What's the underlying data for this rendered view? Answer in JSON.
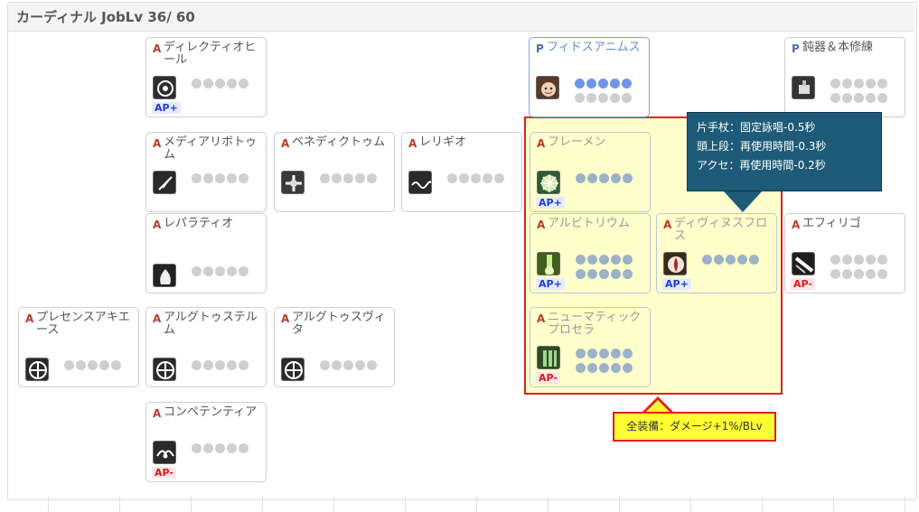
{
  "title": "カーディナル JobLv 36/ 60",
  "colors": {
    "accent_blue": "#6e95e8",
    "highlight_border": "#e02020",
    "tooltip_bg": "#1e5b78",
    "callout_bg": "#ffff33"
  },
  "skills": [
    {
      "id": "s1",
      "type": "A",
      "name": "ディレクティオヒール",
      "dots": [
        "off",
        "off",
        "off",
        "off",
        "off"
      ],
      "badge": "AP+",
      "icon": "heal-swirl-icon"
    },
    {
      "id": "s2",
      "type": "P",
      "name": "フィドスアニムス",
      "dots": [
        "on",
        "on",
        "on",
        "on",
        "on",
        "off",
        "off",
        "off",
        "off",
        "off"
      ],
      "badge": "",
      "icon": "face-icon"
    },
    {
      "id": "s3",
      "type": "P",
      "name": "鈍器＆本修練",
      "dots": [
        "off",
        "off",
        "off",
        "off",
        "off",
        "off",
        "off",
        "off",
        "off",
        "off"
      ],
      "badge": "",
      "icon": "book-mace-icon"
    },
    {
      "id": "s4",
      "type": "A",
      "name": "メディアリボトゥム",
      "dots": [
        "off",
        "off",
        "off",
        "off",
        "off"
      ],
      "badge": "",
      "icon": "feather-icon"
    },
    {
      "id": "s5",
      "type": "A",
      "name": "ベネディクトゥム",
      "dots": [
        "off",
        "off",
        "off",
        "off",
        "off"
      ],
      "badge": "",
      "icon": "cross-burst-icon"
    },
    {
      "id": "s6",
      "type": "A",
      "name": "レリギオ",
      "dots": [
        "off",
        "off",
        "off",
        "off",
        "off"
      ],
      "badge": "",
      "icon": "wave-icon"
    },
    {
      "id": "s7",
      "type": "A",
      "name": "フレーメン",
      "dots": [
        "in",
        "in",
        "in",
        "in",
        "in"
      ],
      "badge": "AP+",
      "icon": "flash-icon"
    },
    {
      "id": "s8",
      "type": "A",
      "name": "レパラティオ",
      "dots": [
        "off",
        "off",
        "off",
        "off",
        "off"
      ],
      "badge": "",
      "icon": "angel-icon"
    },
    {
      "id": "s9",
      "type": "A",
      "name": "アルビトリウム",
      "dots": [
        "in",
        "in",
        "in",
        "in",
        "in",
        "in",
        "in",
        "in",
        "in",
        "in"
      ],
      "badge": "AP+",
      "icon": "light-pillar-icon"
    },
    {
      "id": "s10",
      "type": "A",
      "name": "ディヴィヌスフロス",
      "dots": [
        "in",
        "in",
        "in",
        "in",
        "in"
      ],
      "badge": "AP+",
      "icon": "lily-icon"
    },
    {
      "id": "s11",
      "type": "A",
      "name": "エフィリゴ",
      "dots": [
        "off",
        "off",
        "off",
        "off",
        "off",
        "off",
        "off",
        "off",
        "off",
        "off"
      ],
      "badge": "AP-",
      "icon": "beam-icon"
    },
    {
      "id": "s12",
      "type": "A",
      "name": "プレセンスアキエース",
      "dots": [
        "off",
        "off",
        "off",
        "off",
        "off"
      ],
      "badge": "",
      "icon": "circle-rune-icon"
    },
    {
      "id": "s13",
      "type": "A",
      "name": "アルグトゥステルム",
      "dots": [
        "off",
        "off",
        "off",
        "off",
        "off"
      ],
      "badge": "",
      "icon": "circle-rune-icon"
    },
    {
      "id": "s14",
      "type": "A",
      "name": "アルグトゥスヴィタ",
      "dots": [
        "off",
        "off",
        "off",
        "off",
        "off"
      ],
      "badge": "",
      "icon": "circle-rune-icon"
    },
    {
      "id": "s15",
      "type": "A",
      "name": "ニューマティックプロセラ",
      "dots": [
        "in",
        "in",
        "in",
        "in",
        "in",
        "in",
        "in",
        "in",
        "in",
        "in"
      ],
      "badge": "AP-",
      "icon": "pillars-icon"
    },
    {
      "id": "s16",
      "type": "A",
      "name": "コンペテンティア",
      "dots": [
        "off",
        "off",
        "off",
        "off",
        "off"
      ],
      "badge": "AP-",
      "icon": "winged-icon"
    }
  ],
  "tooltip": {
    "lines": [
      "片手杖：固定詠唱-0.5秒",
      "頭上段：再使用時間-0.3秒",
      "アクセ：再使用時間-0.2秒"
    ]
  },
  "callout": {
    "text": "全装備：ダメージ+1%/BLv"
  }
}
